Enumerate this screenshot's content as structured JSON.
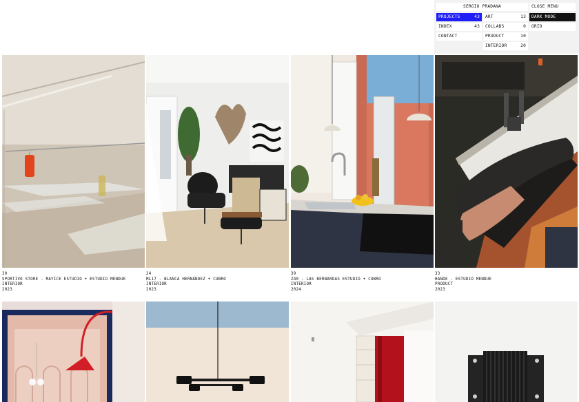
{
  "menu": {
    "brand": "SERGIO PRADANA",
    "close_menu": "CLOSE MENU",
    "dark_mode": "DARK MODE",
    "grid": "GRID",
    "main": [
      {
        "label": "PROJECTS",
        "count": "43"
      },
      {
        "label": "INDEX",
        "count": "43"
      },
      {
        "label": "CONTACT",
        "count": ""
      }
    ],
    "categories": [
      {
        "label": "ART",
        "count": "13"
      },
      {
        "label": "COLLABS",
        "count": "0"
      },
      {
        "label": "PRODUCT",
        "count": "10"
      },
      {
        "label": "INTERIOR",
        "count": "20"
      }
    ]
  },
  "projects": [
    {
      "number": "30",
      "title": "SPORTIVO STORE - MAYICE ESTUDIO + ESTUDIO MENDUE",
      "category": "INTERIOR",
      "year": "2023",
      "image_icon": "store-interior-image"
    },
    {
      "number": "24",
      "title": "ML17 - BLANCA HERNÁNDEZ + CUBRO",
      "category": "INTERIOR",
      "year": "2023",
      "image_icon": "living-room-image"
    },
    {
      "number": "39",
      "title": "Z40 - LAS BERNARDAS ESTUDIO + CUBRO",
      "category": "INTERIOR",
      "year": "2024",
      "image_icon": "kitchen-image"
    },
    {
      "number": "33",
      "title": "HANDE - ESTUDIO MENDUE",
      "category": "PRODUCT",
      "year": "2023",
      "image_icon": "leather-roll-image"
    },
    {
      "image_icon": "arch-lamp-image"
    },
    {
      "image_icon": "pendant-lamp-image"
    },
    {
      "image_icon": "curtain-room-image"
    },
    {
      "image_icon": "sculpture-image"
    }
  ],
  "colors": {
    "accent_blue": "#1f1ff5",
    "dark": "#111111",
    "menu_bg": "#f2f2f2"
  }
}
